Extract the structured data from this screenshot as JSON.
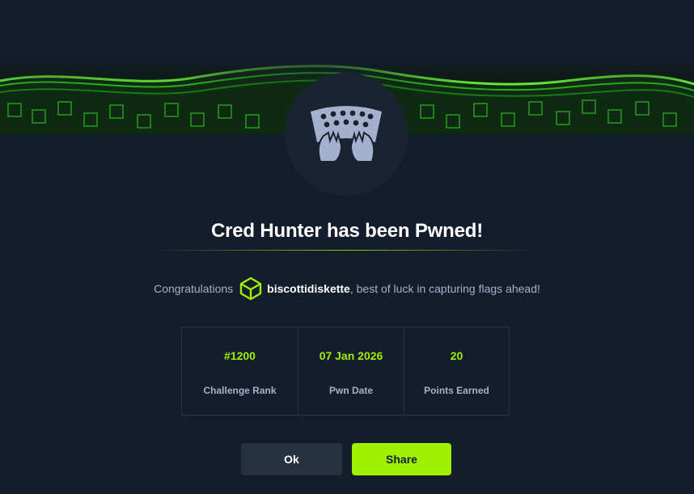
{
  "modal": {
    "banner_icon": "green-cube-wave-banner",
    "machine_icon": "keyboard-hands-icon",
    "title": "Cred Hunter has been Pwned!",
    "congrats_prefix": "Congratulations",
    "user_icon": "hexagon-cube-icon",
    "username": "biscottidiskette",
    "congrats_suffix": ", best of luck in capturing flags ahead!",
    "stats": [
      {
        "value": "#1200",
        "label": "Challenge Rank"
      },
      {
        "value": "07 Jan 2026",
        "label": "Pwn Date"
      },
      {
        "value": "20",
        "label": "Points Earned"
      }
    ],
    "ok_label": "Ok",
    "share_label": "Share"
  },
  "colors": {
    "background": "#141d2b",
    "accent": "#9fef00",
    "text_muted": "#a4b1cd",
    "button_secondary": "#263142"
  }
}
